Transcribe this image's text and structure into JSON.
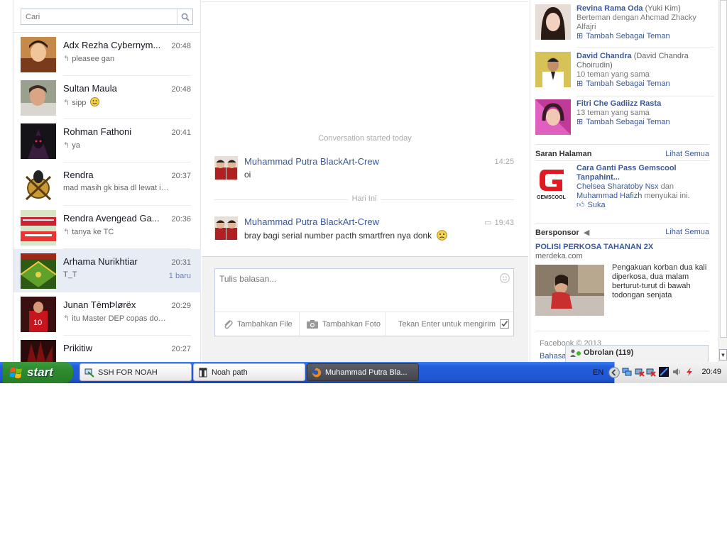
{
  "colors": {
    "fb_blue": "#3b5998",
    "taskbar_blue": "#245edb",
    "start_green": "#2f8a2f"
  },
  "search": {
    "placeholder": "Cari",
    "icon": "search-icon"
  },
  "conversations": [
    {
      "name": "Adx Rezha Cybernym...",
      "time": "20:48",
      "snippet": "pleasee gan",
      "replied": true
    },
    {
      "name": "Sultan Maula",
      "time": "20:48",
      "snippet": "sipp",
      "replied": true,
      "emoji": "smile"
    },
    {
      "name": "Rohman Fathoni",
      "time": "20:41",
      "snippet": "ya",
      "replied": true
    },
    {
      "name": "Rendra",
      "time": "20:37",
      "snippet": "mad masih gk bisa dl lewat id...",
      "replied": false
    },
    {
      "name": "Rendra Avengead Ga...",
      "time": "20:36",
      "snippet": "tanya ke TC",
      "replied": true
    },
    {
      "name": "Arhama Nurikhtiar",
      "time": "20:31",
      "snippet": "T_T",
      "replied": false,
      "badge": "1 baru",
      "active": true
    },
    {
      "name": "Junan TēmÞlørëx",
      "time": "20:29",
      "snippet": "itu Master DEP copas doc ...",
      "replied": true
    },
    {
      "name": "Prikitiw",
      "time": "20:27",
      "snippet": "",
      "replied": false
    }
  ],
  "thread": {
    "started": "Conversation started today",
    "messages": [
      {
        "sender": "Muhammad Putra BlackArt-Crew",
        "time": "14:25",
        "text": "oi"
      },
      {
        "sender": "Muhammad Putra BlackArt-Crew",
        "time": "19:43",
        "text": "bray bagi serial number pacth smartfren nya donk"
      }
    ],
    "day_separator": "Hari Ini"
  },
  "composer": {
    "placeholder": "Tulis balasan...",
    "add_file": "Tambahkan File",
    "add_photo": "Tambahkan Foto",
    "enter_hint": "Tekan Enter untuk mengirim"
  },
  "friends": [
    {
      "name": "Revina Rama Oda",
      "alias": "(Yuki Kim)",
      "sub": "Berteman dengan Ahcmad Zhacky Alfajri",
      "action": "Tambah Sebagai Teman"
    },
    {
      "name": "David Chandra",
      "alias": "(David Chandra Choirudin)",
      "sub": "10 teman yang sama",
      "action": "Tambah Sebagai Teman"
    },
    {
      "name": "Fitri Che Gadiizz Rasta",
      "alias": "",
      "sub": "13 teman yang sama",
      "action": "Tambah Sebagai Teman"
    }
  ],
  "page_suggestions": {
    "title": "Saran Halaman",
    "see_all": "Lihat Semua",
    "page_name": "Cara Ganti Pass Gemscool Tanpahint...",
    "logo_text": "GEMSCOOL",
    "likers_1": "Chelsea Sharatoby Nsx",
    "likers_and": " dan ",
    "likers_2": "Muhammad Hafizh",
    "likers_suffix": " menyukai ini.",
    "like_action": "Suka"
  },
  "sponsored": {
    "title": "Bersponsor",
    "see_all": "Lihat Semua",
    "ad_title": "POLISI PERKOSA TAHANAN 2X",
    "ad_domain": "merdeka.com",
    "ad_body": "Pengakuan korban dua kali diperkosa, dua malam berturut-turut di bawah todongan senjata"
  },
  "footer": {
    "copyright": "Facebook © 2013",
    "language": "Bahasa"
  },
  "chat": {
    "label": "Obrolan (119)"
  },
  "taskbar": {
    "start": "start",
    "tasks": [
      {
        "label": "SSH FOR NOAH",
        "active": false
      },
      {
        "label": "Noah path",
        "active": false
      },
      {
        "label": "Muhammad Putra Bla...",
        "active": true
      }
    ],
    "language": "EN",
    "clock": "20:49"
  }
}
